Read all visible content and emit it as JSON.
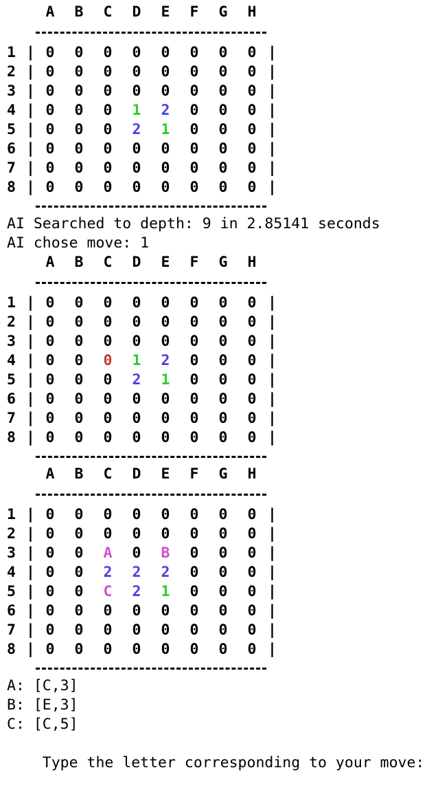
{
  "terminal": {
    "columns": [
      "A",
      "B",
      "C",
      "D",
      "E",
      "F",
      "G",
      "H"
    ],
    "rows": [
      "1",
      "2",
      "3",
      "4",
      "5",
      "6",
      "7",
      "8"
    ],
    "bar": "|",
    "rule": "------------------------",
    "colors": {
      "default": "#000000",
      "p1": "#2ecc2e",
      "p2": "#4a3ee0",
      "last": "#c0392b",
      "option": "#d04fd0"
    },
    "boards": [
      {
        "cells": [
          [
            "0",
            "0",
            "0",
            "0",
            "0",
            "0",
            "0",
            "0"
          ],
          [
            "0",
            "0",
            "0",
            "0",
            "0",
            "0",
            "0",
            "0"
          ],
          [
            "0",
            "0",
            "0",
            "0",
            "0",
            "0",
            "0",
            "0"
          ],
          [
            "0",
            "0",
            "0",
            "1",
            "2",
            "0",
            "0",
            "0"
          ],
          [
            "0",
            "0",
            "0",
            "2",
            "1",
            "0",
            "0",
            "0"
          ],
          [
            "0",
            "0",
            "0",
            "0",
            "0",
            "0",
            "0",
            "0"
          ],
          [
            "0",
            "0",
            "0",
            "0",
            "0",
            "0",
            "0",
            "0"
          ],
          [
            "0",
            "0",
            "0",
            "0",
            "0",
            "0",
            "0",
            "0"
          ]
        ]
      },
      {
        "cells": [
          [
            "0",
            "0",
            "0",
            "0",
            "0",
            "0",
            "0",
            "0"
          ],
          [
            "0",
            "0",
            "0",
            "0",
            "0",
            "0",
            "0",
            "0"
          ],
          [
            "0",
            "0",
            "0",
            "0",
            "0",
            "0",
            "0",
            "0"
          ],
          [
            "0",
            "0",
            "0",
            "1",
            "2",
            "0",
            "0",
            "0"
          ],
          [
            "0",
            "0",
            "0",
            "2",
            "1",
            "0",
            "0",
            "0"
          ],
          [
            "0",
            "0",
            "0",
            "0",
            "0",
            "0",
            "0",
            "0"
          ],
          [
            "0",
            "0",
            "0",
            "0",
            "0",
            "0",
            "0",
            "0"
          ],
          [
            "0",
            "0",
            "0",
            "0",
            "0",
            "0",
            "0",
            "0"
          ]
        ],
        "highlight": {
          "row": 3,
          "col": 2,
          "style": "last"
        }
      },
      {
        "cells": [
          [
            "0",
            "0",
            "0",
            "0",
            "0",
            "0",
            "0",
            "0"
          ],
          [
            "0",
            "0",
            "0",
            "0",
            "0",
            "0",
            "0",
            "0"
          ],
          [
            "0",
            "0",
            "A",
            "0",
            "B",
            "0",
            "0",
            "0"
          ],
          [
            "0",
            "0",
            "2",
            "2",
            "2",
            "0",
            "0",
            "0"
          ],
          [
            "0",
            "0",
            "C",
            "2",
            "1",
            "0",
            "0",
            "0"
          ],
          [
            "0",
            "0",
            "0",
            "0",
            "0",
            "0",
            "0",
            "0"
          ],
          [
            "0",
            "0",
            "0",
            "0",
            "0",
            "0",
            "0",
            "0"
          ],
          [
            "0",
            "0",
            "0",
            "0",
            "0",
            "0",
            "0",
            "0"
          ]
        ]
      }
    ],
    "ai_search_line": "AI Searched to depth: 9 in 2.85141 seconds",
    "ai_move_line": "AI chose move: 1",
    "options": [
      "A: [C,3]",
      "B: [E,3]",
      "C: [C,5]"
    ],
    "prompt": "Type the letter corresponding to your move:"
  }
}
